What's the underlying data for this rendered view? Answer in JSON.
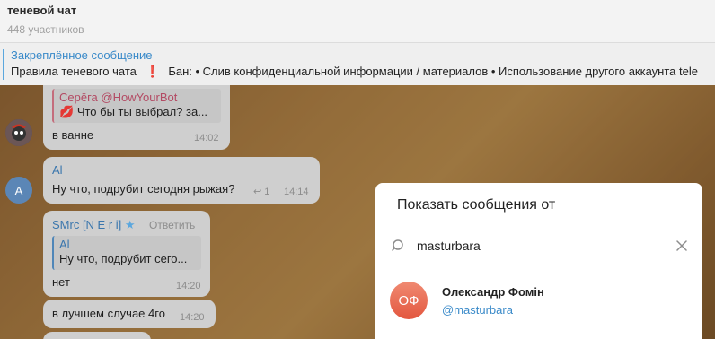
{
  "header": {
    "title": "теневой чат",
    "subtitle": "448 участников"
  },
  "pinned": {
    "title": "Закреплённое сообщение",
    "text_before": "Правила теневого чата",
    "icon": "exclamation",
    "text_after": "Бан: • Слив конфиденциальной информации / материалов • Использование другого аккаунта tele"
  },
  "messages": [
    {
      "reply_author": "Серёга @HowYourBot",
      "reply_icon": "lips",
      "reply_text": "Что бы ты выбрал? за...",
      "text": "в ванне",
      "time": "14:02"
    },
    {
      "author": "Al",
      "avatar_letter": "A",
      "text": "Ну что, подрубит сегодня рыжая?",
      "replies": "1",
      "time": "14:14"
    },
    {
      "author": "SMrc [N E r i]",
      "reply_action": "Ответить",
      "reply_author": "Al",
      "reply_text": "Ну что, подрубит сего...",
      "text": "нет",
      "time": "14:20"
    },
    {
      "text": "в лучшем случае 4го",
      "time": "14:20"
    }
  ],
  "dialog": {
    "title": "Показать сообщения от",
    "search_value": "masturbara",
    "result": {
      "initials": "ОФ",
      "name": "Олександр Фомін",
      "username": "@masturbara"
    }
  },
  "colors": {
    "accent": "#3a8ac9",
    "avatar_gradient": "#e3573f"
  }
}
